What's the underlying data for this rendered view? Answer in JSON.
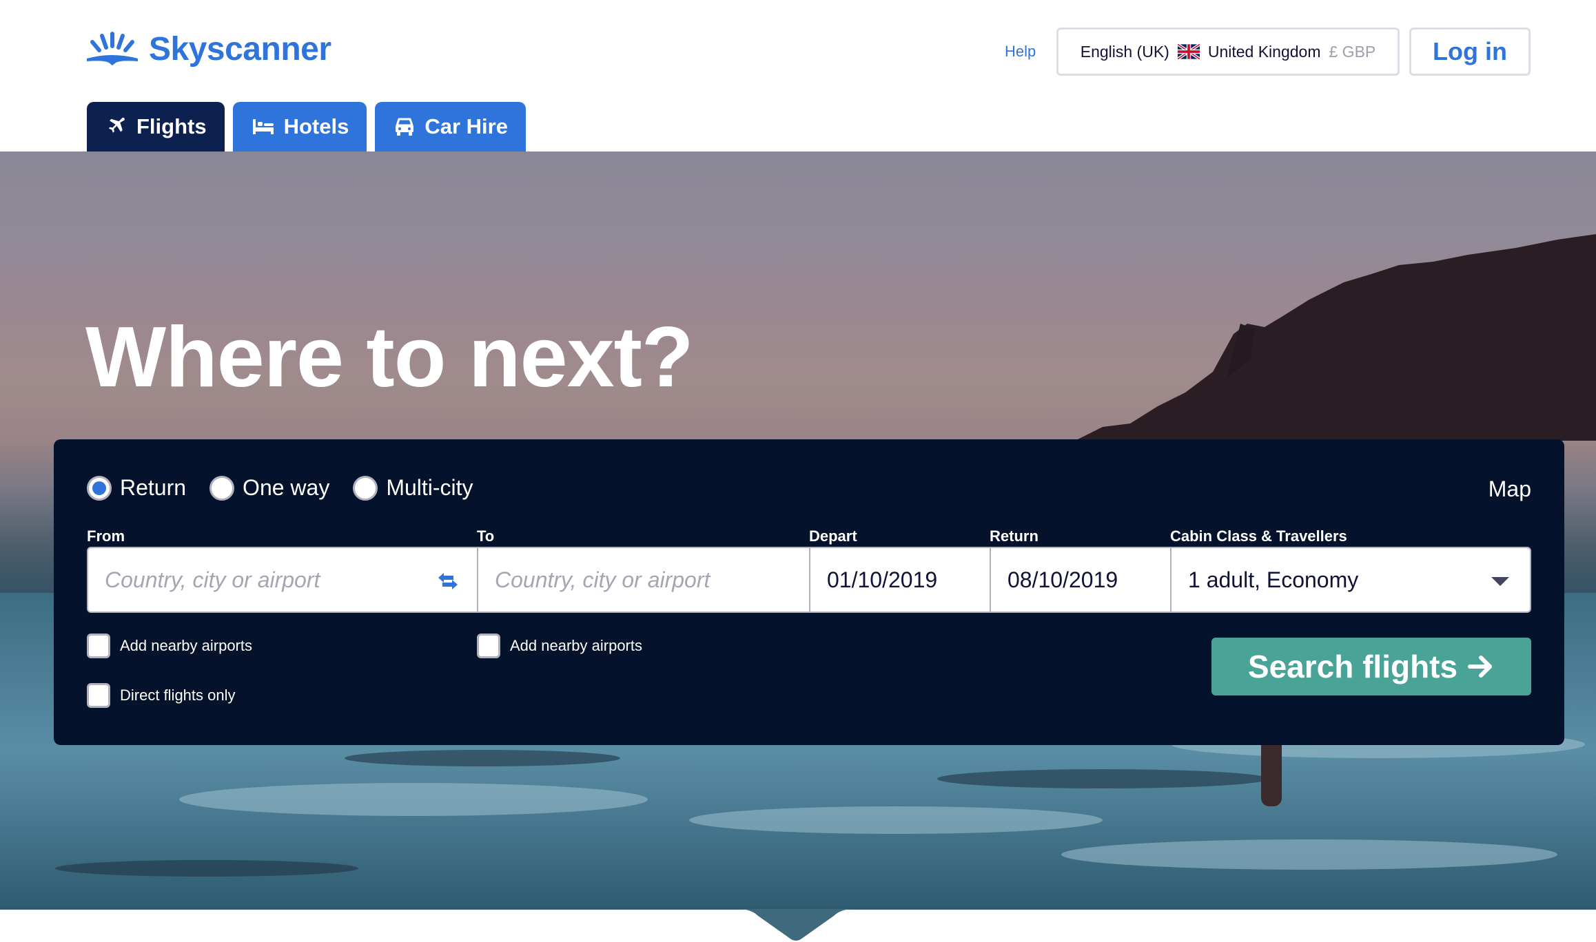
{
  "header": {
    "brand": "Skyscanner",
    "help_label": "Help",
    "locale": {
      "language": "English (UK)",
      "country": "United Kingdom",
      "currency": "£ GBP",
      "flag_icon": "uk-flag-icon"
    },
    "login_label": "Log in"
  },
  "tabs": [
    {
      "label": "Flights",
      "icon": "plane-icon",
      "active": true
    },
    {
      "label": "Hotels",
      "icon": "bed-icon",
      "active": false
    },
    {
      "label": "Car Hire",
      "icon": "car-icon",
      "active": false
    }
  ],
  "hero": {
    "title": "Where to next?"
  },
  "search": {
    "trip_types": [
      {
        "label": "Return",
        "checked": true
      },
      {
        "label": "One way",
        "checked": false
      },
      {
        "label": "Multi-city",
        "checked": false
      }
    ],
    "map_label": "Map",
    "from": {
      "label": "From",
      "placeholder": "Country, city or airport",
      "value": ""
    },
    "to": {
      "label": "To",
      "placeholder": "Country, city or airport",
      "value": ""
    },
    "depart": {
      "label": "Depart",
      "value": "01/10/2019"
    },
    "return": {
      "label": "Return",
      "value": "08/10/2019"
    },
    "cabin": {
      "label": "Cabin Class & Travellers",
      "value": "1 adult, Economy"
    },
    "options": {
      "from_nearby": {
        "label": "Add nearby airports",
        "checked": false
      },
      "to_nearby": {
        "label": "Add nearby airports",
        "checked": false
      },
      "direct_only": {
        "label": "Direct flights only",
        "checked": false
      }
    },
    "search_button_label": "Search flights"
  },
  "colors": {
    "brand_blue": "#2f74db",
    "active_tab": "#0d2150",
    "panel_bg": "#05122b",
    "search_button": "#49a497"
  }
}
